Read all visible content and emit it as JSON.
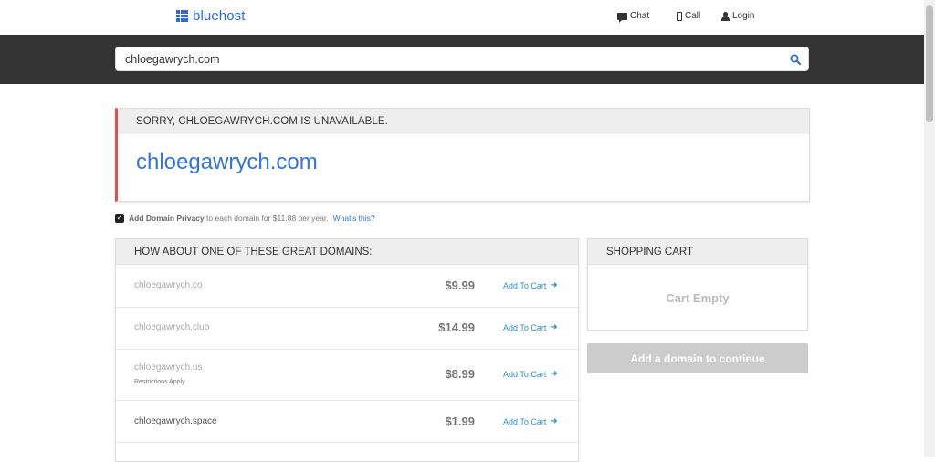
{
  "header": {
    "logo_text": "bluehost",
    "nav": {
      "chat": "Chat",
      "call": "Call",
      "login": "Login"
    }
  },
  "search": {
    "value": "chloegawrych.com"
  },
  "unavailable": {
    "heading": "SORRY, CHLOEGAWRYCH.COM IS UNAVAILABLE.",
    "domain": "chloegawrych.com"
  },
  "privacy": {
    "checked": true,
    "bold": "Add Domain Privacy",
    "text": " to each domain for $11.88 per year.",
    "link": "What's this?"
  },
  "suggestions": {
    "heading": "HOW ABOUT ONE OF THESE GREAT DOMAINS:",
    "add_label": "Add To Cart",
    "items": [
      {
        "domain": "chloegawrych.co",
        "price": "$9.99",
        "note": ""
      },
      {
        "domain": "chloegawrych.club",
        "price": "$14.99",
        "note": ""
      },
      {
        "domain": "chloegawrych.us",
        "price": "$8.99",
        "note": "Restrictions Apply"
      },
      {
        "domain": "chloegawrych.space",
        "price": "$1.99",
        "note": ""
      }
    ]
  },
  "cart": {
    "heading": "SHOPPING CART",
    "empty_text": "Cart Empty",
    "continue_label": "Add a domain to continue"
  },
  "colors": {
    "brand": "#2f6ad4",
    "link": "#3575d3",
    "alert": "#d9534f",
    "band": "#333333"
  }
}
